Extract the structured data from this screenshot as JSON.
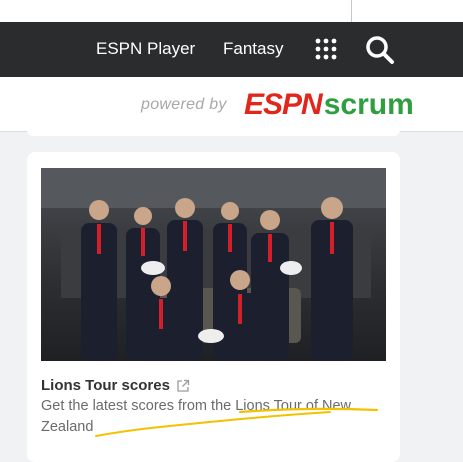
{
  "nav": {
    "player_label": "ESPN Player",
    "fantasy_label": "Fantasy",
    "apps_icon": "grid-dots-icon",
    "search_icon": "search-icon"
  },
  "powered": {
    "text": "powered by",
    "logo_espn": "ESPN",
    "logo_scrum": "scrum"
  },
  "story": {
    "title": "Lions Tour scores",
    "description": "Get the latest scores from the Lions Tour of New Zealand",
    "external_icon": "external-link-icon"
  },
  "colors": {
    "navbar": "#2b2c2d",
    "espn_red": "#e1261c",
    "scrum_green": "#2e9e3e",
    "annotation": "#f2c200"
  }
}
